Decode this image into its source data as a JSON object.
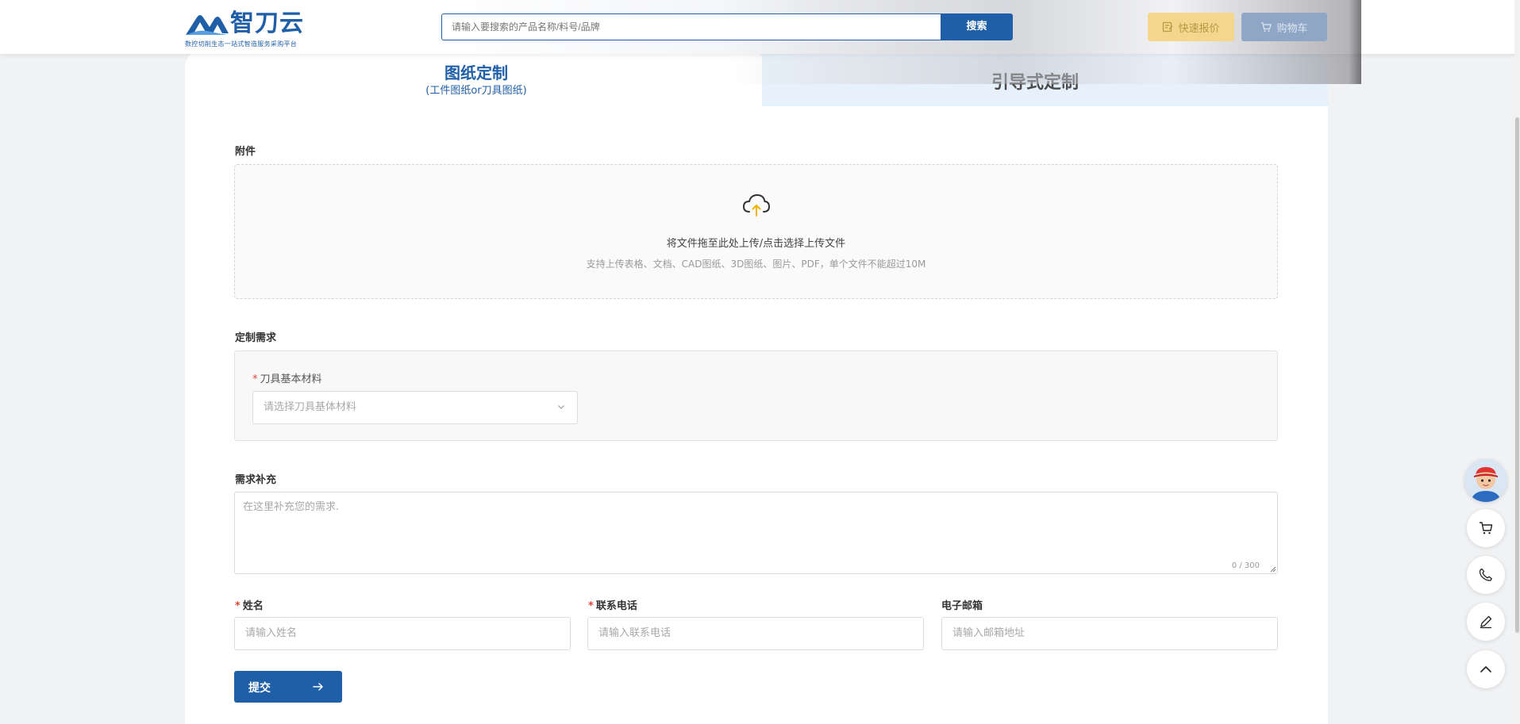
{
  "header": {
    "logo_text": "智刀云",
    "logo_tagline": "数控切削生态一站式智造服务采购平台",
    "search_placeholder": "请输入要搜索的产品名称/料号/品牌",
    "search_button": "搜索",
    "quick_quote": "快速报价",
    "cart": "购物车"
  },
  "tabs": {
    "drawing": {
      "label": "图纸定制",
      "sub": "(工件图纸or刀具图纸)"
    },
    "guided": {
      "label": "引导式定制"
    }
  },
  "attachment": {
    "label": "附件",
    "upload_main": "将文件拖至此处上传/点击选择上传文件",
    "upload_hint": "支持上传表格、文档、CAD图纸、3D图纸、图片、PDF，单个文件不能超过10M"
  },
  "requirement": {
    "label": "定制需求",
    "material_label": "刀具基本材料",
    "material_placeholder": "请选择刀具基体材料"
  },
  "supplement": {
    "label": "需求补充",
    "placeholder": "在这里补充您的需求.",
    "count": "0 / 300"
  },
  "contact": {
    "name_label": "姓名",
    "name_placeholder": "请输入姓名",
    "phone_label": "联系电话",
    "phone_placeholder": "请输入联系电话",
    "email_label": "电子邮箱",
    "email_placeholder": "请输入邮箱地址",
    "required_mark": "*"
  },
  "submit": {
    "label": "提交"
  },
  "colors": {
    "brand_blue": "#1f5fa8",
    "quote_yellow": "#f4d78c",
    "cart_blue": "#8fa6c7",
    "required_red": "#e0463a"
  },
  "float_bar": {
    "icons": [
      "avatar",
      "cart-icon",
      "phone-icon",
      "edit-icon",
      "arrow-up-icon"
    ]
  }
}
